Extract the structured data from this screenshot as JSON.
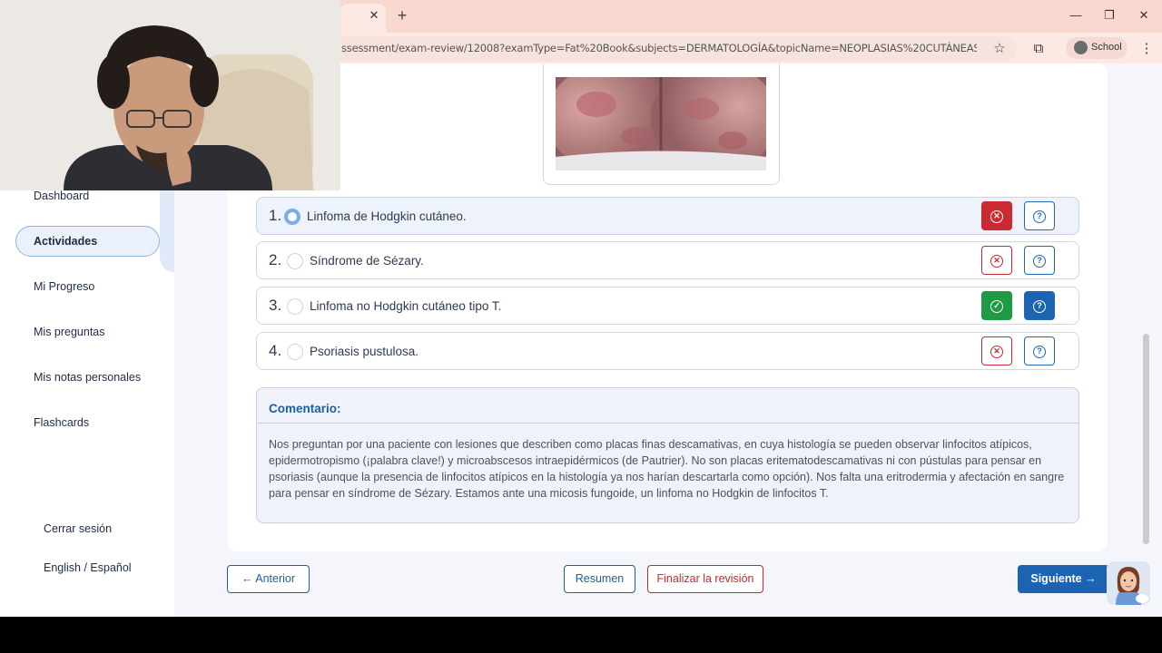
{
  "browser": {
    "tab_close": "✕",
    "new_tab": "+",
    "url": "ssessment/exam-review/12008?examType=Fat%20Book&subjects=DERMATOLOGÍA&topicName=NEOPLASIAS%20CUTÁNEAS",
    "profile_label": "School"
  },
  "sidebar": {
    "items": [
      {
        "label": "Dashboard"
      },
      {
        "label": "Actividades"
      },
      {
        "label": "Mi Progreso"
      },
      {
        "label": "Mis preguntas"
      },
      {
        "label": "Mis notas personales"
      },
      {
        "label": "Flashcards"
      }
    ],
    "logout": "Cerrar sesión",
    "language": "English / Español"
  },
  "question": {
    "options": [
      {
        "number": "1.",
        "text": "Linfoma de Hodgkin cutáneo.",
        "selected": true,
        "status": "incorrect"
      },
      {
        "number": "2.",
        "text": "Síndrome de Sézary.",
        "selected": false,
        "status": "neutral"
      },
      {
        "number": "3.",
        "text": "Linfoma no Hodgkin cutáneo tipo T.",
        "selected": false,
        "status": "correct"
      },
      {
        "number": "4.",
        "text": "Psoriasis pustulosa.",
        "selected": false,
        "status": "neutral"
      }
    ]
  },
  "comment": {
    "title": "Comentario:",
    "text": "Nos preguntan por una paciente con lesiones que describen como placas finas descamativas, en cuya histología se pueden observar linfocitos atípicos, epidermotropismo (¡palabra clave!) y microabscesos intraepidérmicos (de Pautrier). No son placas eritematodescamativas ni con pústulas para pensar en psoriasis (aunque la presencia de linfocitos atípicos en la histología ya nos harían descartarla como opción). Nos falta una eritrodermia y afectación en sangre para pensar en síndrome de Sézary. Estamos ante una micosis fungoide, un linfoma no Hodgkin de linfocitos T."
  },
  "nav": {
    "prev": "← Anterior",
    "summary": "Resumen",
    "finish": "Finalizar la revisión",
    "next": "Siguiente →"
  },
  "colors": {
    "primary": "#1c64b1",
    "danger": "#cc2a31",
    "success": "#1f9a45",
    "chrome": "#f9d8cf"
  }
}
